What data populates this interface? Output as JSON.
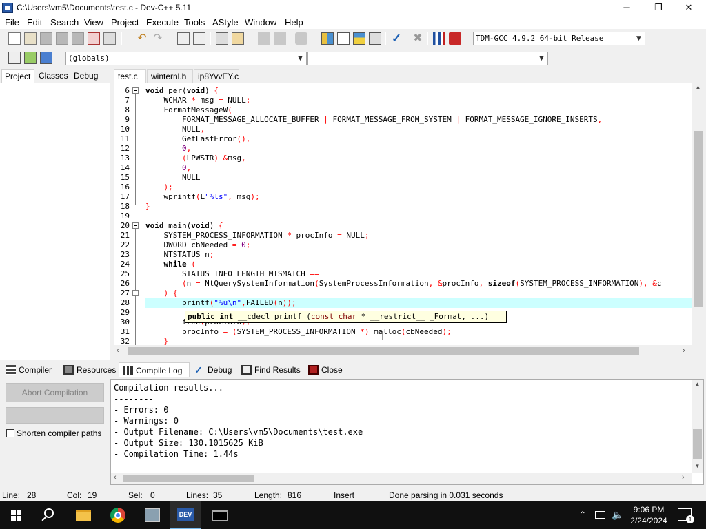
{
  "window": {
    "title": "C:\\Users\\vm5\\Documents\\test.c - Dev-C++ 5.11",
    "minimize_label": "─",
    "maximize_label": "❐",
    "close_label": "✕"
  },
  "menu": [
    "File",
    "Edit",
    "Search",
    "View",
    "Project",
    "Execute",
    "Tools",
    "AStyle",
    "Window",
    "Help"
  ],
  "toolbar": {
    "compiler_select": "TDM-GCC 4.9.2 64-bit Release",
    "scope_select": "(globals)",
    "function_select": ""
  },
  "left_tabs": [
    "Project",
    "Classes",
    "Debug"
  ],
  "editor_tabs": [
    "test.c",
    "winternl.h",
    "ip8YvvEY.c"
  ],
  "line_numbers": [
    "6",
    "7",
    "8",
    "9",
    "10",
    "11",
    "12",
    "13",
    "14",
    "15",
    "16",
    "17",
    "18",
    "19",
    "20",
    "21",
    "22",
    "23",
    "24",
    "25",
    "26",
    "27",
    "28",
    "29",
    "30",
    "31",
    "32"
  ],
  "tooltip": {
    "kw1": "public",
    "kw2": "int",
    "rest1": "__cdecl printf (",
    "const_kw": "const",
    "char_kw": "char",
    "rest2": "* __restrict__ _Format, ...)"
  },
  "bottom_tabs": [
    "Compiler",
    "Resources",
    "Compile Log",
    "Debug",
    "Find Results",
    "Close"
  ],
  "compile_panel": {
    "abort_button": "Abort Compilation",
    "shorten_paths_label": "Shorten compiler paths",
    "log_lines": [
      "Compilation results...",
      "--------",
      "- Errors: 0",
      "- Warnings: 0",
      "- Output Filename: C:\\Users\\vm5\\Documents\\test.exe",
      "- Output Size: 130.1015625 KiB",
      "- Compilation Time: 1.44s"
    ]
  },
  "statusbar": {
    "line_label": "Line:",
    "line_value": "28",
    "col_label": "Col:",
    "col_value": "19",
    "sel_label": "Sel:",
    "sel_value": "0",
    "lines_label": "Lines:",
    "lines_value": "35",
    "length_label": "Length:",
    "length_value": "816",
    "mode": "Insert",
    "message": "Done parsing in 0.031 seconds"
  },
  "taskbar": {
    "time": "9:06 PM",
    "date": "2/24/2024",
    "notification_count": "1",
    "app_dev_label": "DEV"
  },
  "colors": {
    "highlight_line": "#ccffff",
    "string": "#0000ff",
    "number": "#800080",
    "symbol": "#ff0000",
    "taskbar": "#101010"
  }
}
